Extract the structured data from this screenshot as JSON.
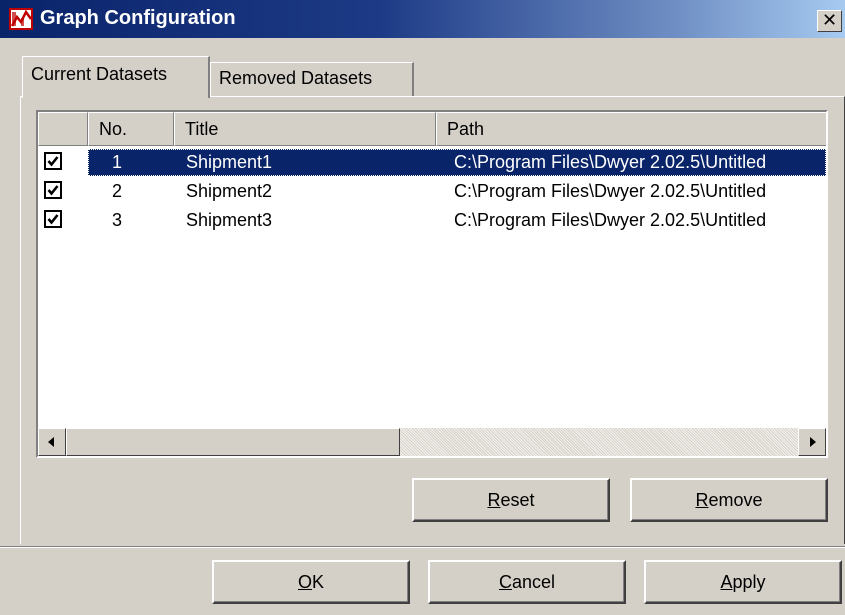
{
  "window": {
    "title": "Graph Configuration",
    "close_glyph": "✕"
  },
  "tabs": [
    {
      "label": "Current Datasets",
      "active": true
    },
    {
      "label": "Removed Datasets",
      "active": false
    }
  ],
  "table": {
    "columns": [
      "",
      "No.",
      "Title",
      "Path"
    ],
    "rows": [
      {
        "checked": true,
        "no": "1",
        "title": "Shipment1",
        "path": "C:\\Program Files\\Dwyer 2.02.5\\Untitled",
        "selected": true
      },
      {
        "checked": true,
        "no": "2",
        "title": "Shipment2",
        "path": "C:\\Program Files\\Dwyer 2.02.5\\Untitled",
        "selected": false
      },
      {
        "checked": true,
        "no": "3",
        "title": "Shipment3",
        "path": "C:\\Program Files\\Dwyer 2.02.5\\Untitled",
        "selected": false
      }
    ]
  },
  "buttons": {
    "reset": {
      "accel": "R",
      "rest": "eset"
    },
    "remove": {
      "accel": "R",
      "rest": "emove"
    },
    "ok": {
      "accel": "O",
      "rest": "K"
    },
    "cancel": {
      "accel": "C",
      "rest": "ancel"
    },
    "apply": {
      "accel": "A",
      "rest": "pply"
    }
  },
  "icons": {
    "app": "graph-app-icon",
    "close": "close-icon",
    "scroll_left": "scroll-left-arrow-icon",
    "scroll_right": "scroll-right-arrow-icon",
    "check": "checkmark-icon"
  },
  "colors": {
    "titlebar_start": "#0a246a",
    "titlebar_end": "#a6caf0",
    "selection": "#0a246a",
    "face": "#d4d0c8"
  }
}
